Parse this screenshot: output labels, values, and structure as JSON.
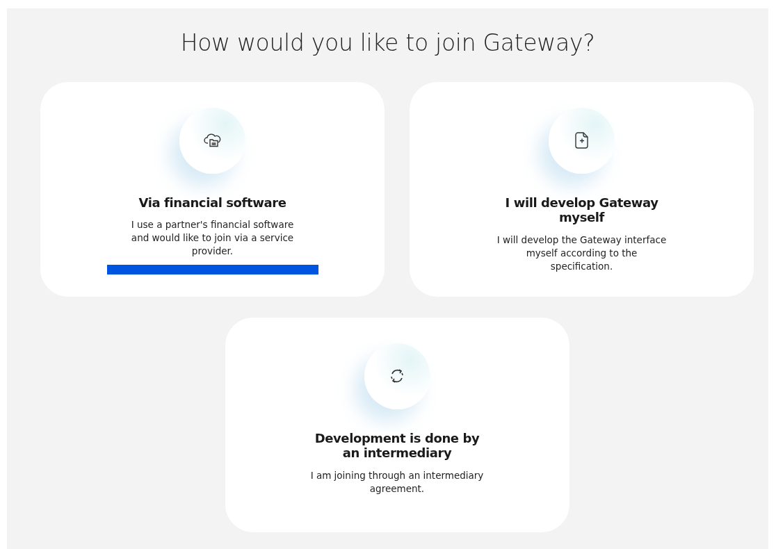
{
  "heading": "How would you like to join Gateway?",
  "options": [
    {
      "kind": "cloud",
      "title": "Via financial software",
      "description": "I use a partner's financial software and would like to join via a service provider.",
      "selected": true
    },
    {
      "kind": "document",
      "title": "I will develop Gateway myself",
      "description": "I will develop the Gateway interface myself according to the specification.",
      "selected": false
    },
    {
      "kind": "cycle",
      "title": "Development is done by an intermediary",
      "description": "I am joining through an intermediary agreement.",
      "selected": false
    }
  ]
}
